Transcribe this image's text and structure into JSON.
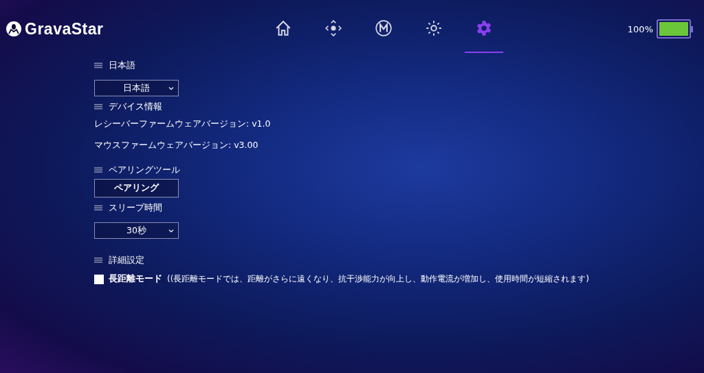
{
  "brand": {
    "name": "GravaStar"
  },
  "nav": [
    {
      "kind": "home",
      "selected": false
    },
    {
      "kind": "dpad",
      "selected": false
    },
    {
      "kind": "macro",
      "selected": false
    },
    {
      "kind": "light",
      "selected": false
    },
    {
      "kind": "settings",
      "selected": true
    }
  ],
  "battery": {
    "reading": "100%",
    "level": 1.0
  },
  "sections": [
    {
      "heading": "日本語",
      "items": [
        {
          "kind": "select",
          "value": "日本語"
        }
      ]
    },
    {
      "heading": "デバイス情報",
      "items": [
        {
          "kind": "text",
          "text": "レシーバーファームウェアバージョン: v1.0"
        },
        {
          "kind": "text",
          "text": "マウスファームウェアバージョン: v3.00"
        }
      ]
    },
    {
      "heading": "ペアリングツール",
      "items": [
        {
          "kind": "button",
          "label": "ペアリング"
        }
      ]
    },
    {
      "heading": "スリープ時間",
      "items": [
        {
          "kind": "select",
          "value": "30秒"
        }
      ]
    },
    {
      "heading": "詳細設定",
      "items": [
        {
          "kind": "checkbox",
          "label": "長距離モード",
          "checked": false,
          "note": "((長距離モードでは、距離がさらに遠くなり、抗干渉能力が向上し、動作電流が増加し、使用時間が短縮されます)"
        }
      ]
    }
  ]
}
